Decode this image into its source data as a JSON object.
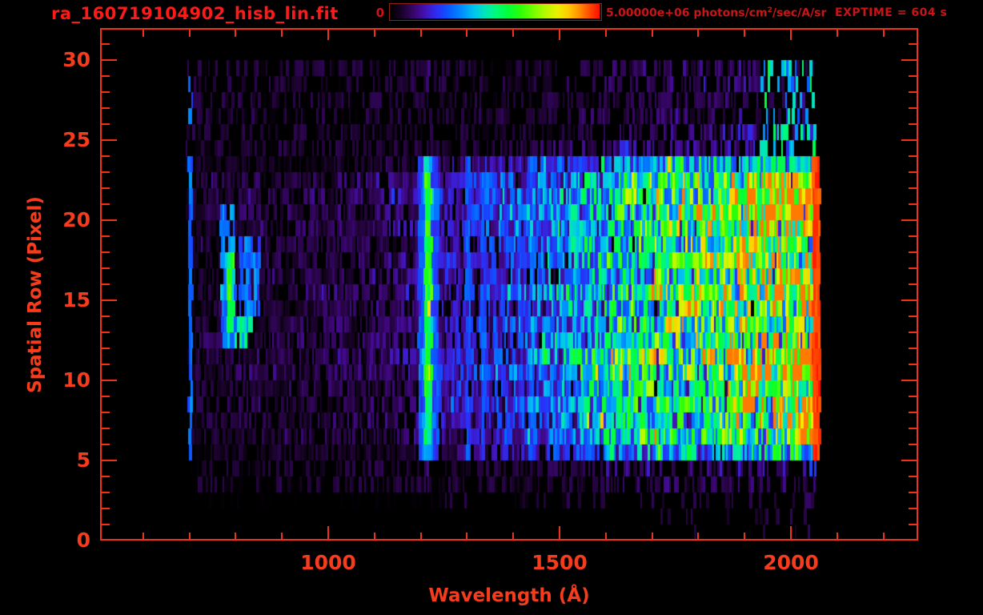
{
  "header": {
    "title": "ra_160719104902_hisb_lin.fit",
    "colorbar_min_label": "0",
    "colorbar_max_value": "5.00000e+06",
    "colorbar_units_prefix": " photons/cm",
    "colorbar_units_sup": "2",
    "colorbar_units_suffix": "/sec/A/sr",
    "exptime_label": "EXPTIME = 604 s"
  },
  "colors": {
    "background": "#000000",
    "frame_red": "#ee3118",
    "tick_label_red": "#f63c1c",
    "title_red": "#ff1a1a",
    "header_text_red": "#cc1414"
  },
  "chart_data": {
    "type": "heatmap",
    "title": "ra_160719104902_hisb_lin.fit",
    "xlabel": "Wavelength (Å)",
    "ylabel": "Spatial Row (Pixel)",
    "x_ticks": [
      1000,
      1500,
      2000
    ],
    "x_minor_tick_step_angstrom": 100,
    "y_ticks": [
      0,
      5,
      10,
      15,
      20,
      25,
      30
    ],
    "y_minor_tick_step_rows": 1,
    "x_axis_range_angstrom": [
      507,
      2275
    ],
    "y_axis_range_rows": [
      0,
      32
    ],
    "rows": 32,
    "exposure_time_s": 604,
    "colorbar": {
      "min_value": 0,
      "min_label": "0",
      "max_value": 5000000,
      "max_label": "5.00000e+06",
      "units": "photons/cm^2/sec/A/sr",
      "colormap": "rainbow-black-to-red"
    },
    "data_wavelength_extent_angstrom": [
      697,
      2063
    ],
    "row_activity": [
      0.03,
      0.06,
      0.1,
      0.16,
      0.22,
      0.62,
      0.82,
      0.88,
      0.92,
      0.95,
      1.05,
      1.08,
      1.0,
      0.98,
      0.96,
      1.0,
      0.98,
      0.96,
      0.94,
      1.04,
      1.08,
      1.12,
      1.02,
      0.72,
      0.26,
      0.2,
      0.18,
      0.16,
      0.16,
      0.16,
      0,
      0
    ],
    "spectrum_bins_angstrom": [
      650,
      700,
      750,
      800,
      900,
      1000,
      1100,
      1150,
      1190,
      1205,
      1216,
      1228,
      1250,
      1300,
      1350,
      1400,
      1450,
      1500,
      1550,
      1600,
      1700,
      1800,
      1900,
      1950,
      2000,
      2040,
      2062,
      2070
    ],
    "spectrum_base_e6": [
      0,
      0.35,
      0.38,
      0.4,
      0.4,
      0.45,
      0.5,
      0.55,
      0.6,
      1.2,
      2.9,
      1.2,
      0.8,
      1.0,
      1.15,
      1.3,
      1.5,
      1.75,
      2.1,
      2.5,
      2.9,
      3.1,
      3.4,
      3.5,
      3.6,
      3.5,
      3.4,
      0
    ],
    "features": {
      "lyman_alpha_line": {
        "wavelength_angstrom": 1216,
        "rows": [
          5,
          23
        ],
        "peak_e6": 3.0
      },
      "detector_red_edge": {
        "wavelength_angstrom": [
          2046,
          2062
        ],
        "rows": [
          5,
          23
        ],
        "peak_e6": 4.8
      },
      "left_edge_blue_line": {
        "wavelength_angstrom": 703,
        "rows": [
          5,
          29
        ],
        "peak_e6": 1.5
      },
      "hot_rows": [
        [
          6,
          12
        ],
        [
          19,
          22
        ]
      ],
      "hot_band_angstrom": [
        1860,
        2045
      ],
      "blue_columns_angstrom": [
        1302,
        1336,
        1440
      ],
      "arc_patches": [
        {
          "rows": [
            12,
            20
          ],
          "wl": [
            768,
            800
          ],
          "amp": 0.34,
          "density": 0.85
        },
        {
          "rows": [
            13,
            17
          ],
          "wl": [
            782,
            799
          ],
          "amp": 0.55,
          "density": 0.9
        },
        {
          "rows": [
            14,
            18
          ],
          "wl": [
            806,
            852
          ],
          "amp": 0.3,
          "density": 0.6
        },
        {
          "rows": [
            12,
            13
          ],
          "wl": [
            798,
            836
          ],
          "amp": 0.44,
          "density": 0.75
        }
      ],
      "top_right_patch": {
        "rows": [
          24,
          29
        ],
        "wl": [
          1935,
          2058
        ],
        "amp": 0.34,
        "density": 0.75
      },
      "row1_blue_marks_angstrom": [
        1838
      ],
      "faint_bottom_patch": {
        "rows": [
          0,
          2
        ],
        "wl": [
          1965,
          2052
        ]
      }
    },
    "colormap_stops": [
      [
        0,
        0,
        0,
        0
      ],
      [
        0.04,
        18,
        2,
        28
      ],
      [
        0.08,
        40,
        4,
        70
      ],
      [
        0.13,
        64,
        8,
        130
      ],
      [
        0.18,
        64,
        24,
        200
      ],
      [
        0.23,
        40,
        50,
        248
      ],
      [
        0.28,
        10,
        90,
        255
      ],
      [
        0.34,
        0,
        140,
        255
      ],
      [
        0.4,
        0,
        195,
        240
      ],
      [
        0.45,
        0,
        228,
        190
      ],
      [
        0.5,
        0,
        248,
        130
      ],
      [
        0.56,
        0,
        255,
        60
      ],
      [
        0.62,
        40,
        255,
        10
      ],
      [
        0.68,
        110,
        255,
        0
      ],
      [
        0.74,
        180,
        250,
        0
      ],
      [
        0.8,
        235,
        240,
        0
      ],
      [
        0.85,
        255,
        205,
        0
      ],
      [
        0.9,
        255,
        150,
        0
      ],
      [
        0.95,
        255,
        80,
        0
      ],
      [
        1.0,
        255,
        15,
        0
      ]
    ],
    "noise_seed": 20160719
  }
}
